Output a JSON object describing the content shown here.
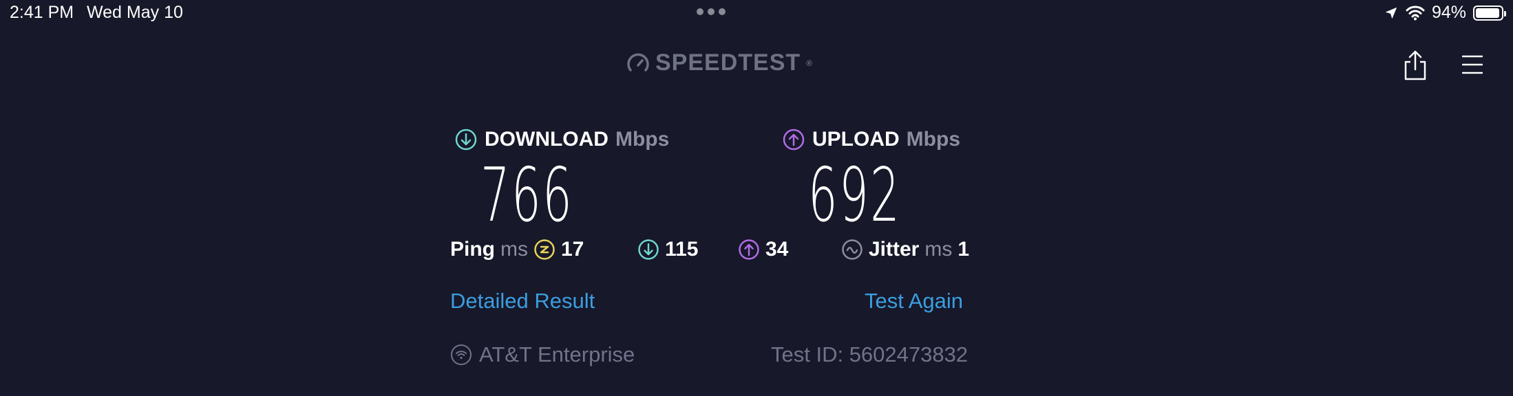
{
  "status": {
    "time": "2:41 PM",
    "date": "Wed May 10",
    "battery": "94%",
    "battery_level": 0.94
  },
  "header": {
    "brand": "SPEEDTEST",
    "brand_mark": "®"
  },
  "download": {
    "label": "DOWNLOAD",
    "unit": "Mbps",
    "value": "766"
  },
  "upload": {
    "label": "UPLOAD",
    "unit": "Mbps",
    "value": "692"
  },
  "ping": {
    "label": "Ping",
    "unit": "ms",
    "idle": "17",
    "download": "115",
    "upload": "34"
  },
  "jitter": {
    "label": "Jitter",
    "unit": "ms",
    "value": "1"
  },
  "actions": {
    "detailed": "Detailed Result",
    "again": "Test Again"
  },
  "footer": {
    "isp": "AT&T Enterprise",
    "test_id": "Test ID: 5602473832"
  },
  "colors": {
    "download": "#6fd6d0",
    "upload": "#b06ce6",
    "ping": "#e8d35a",
    "link": "#3b9ee0"
  }
}
